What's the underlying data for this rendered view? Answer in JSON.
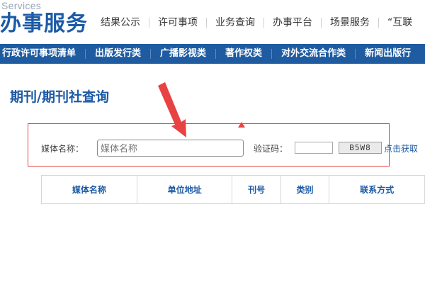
{
  "header": {
    "logo_sub": "Services",
    "logo_main": "办事服务",
    "nav": [
      {
        "label": "结果公示"
      },
      {
        "label": "许可事项"
      },
      {
        "label": "业务查询"
      },
      {
        "label": "办事平台"
      },
      {
        "label": "场景服务"
      },
      {
        "label": "“互联"
      }
    ]
  },
  "subnav": {
    "items": [
      {
        "label": "行政许可事项清单"
      },
      {
        "label": "出版发行类"
      },
      {
        "label": "广播影视类"
      },
      {
        "label": "著作权类"
      },
      {
        "label": "对外交流合作类"
      },
      {
        "label": "新闻出版行"
      }
    ]
  },
  "page": {
    "title": "期刊/期刊社查询"
  },
  "search": {
    "media_label": "媒体名称：",
    "media_placeholder": "媒体名称",
    "media_value": "",
    "captcha_label": "验证码：",
    "captcha_value": "",
    "captcha_code": "B5W8",
    "captcha_refresh": "点击获取"
  },
  "table": {
    "headers": [
      "媒体名称",
      "单位地址",
      "刊号",
      "类别",
      "联系方式"
    ]
  },
  "colors": {
    "brand_blue": "#1c5aa6",
    "subnav_blue": "#1e5ba0",
    "annotation_red": "#e14545"
  },
  "annotation": {
    "arrow_icon": "red-arrow-icon",
    "marker_icon": "red-triangle-icon"
  }
}
